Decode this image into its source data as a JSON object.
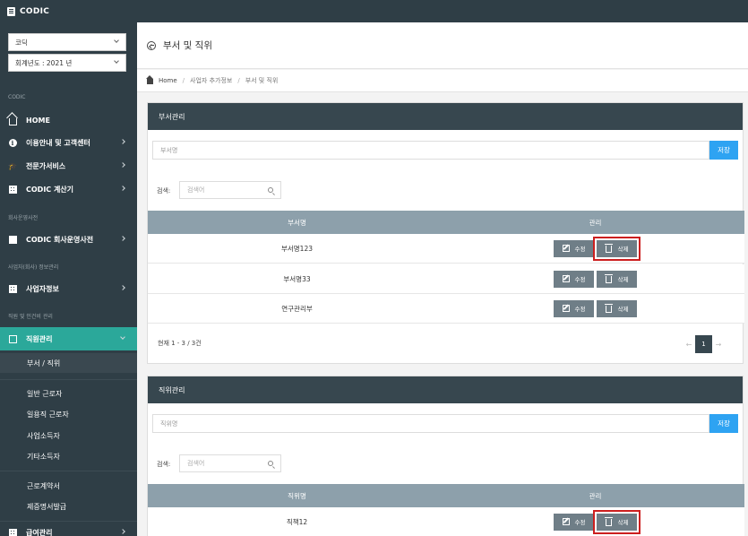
{
  "app": {
    "brand": "CODIC"
  },
  "sidebar": {
    "company_select": "코딕",
    "year_select": "회계년도 : 2021 년",
    "sections": {
      "codic": "CODIC",
      "company_dict": "회사운영사전",
      "biz_info": "사업자(회사) 정보관리",
      "staff": "직원 및 인건비 관리"
    },
    "items": {
      "home": "HOME",
      "support": "이용안내 및 고객센터",
      "expert": "전문가서비스",
      "calculator": "CODIC 계산기",
      "dict": "CODIC 회사운영사전",
      "biz": "사업자정보",
      "staff_mgmt": "직원관리",
      "salary": "급여관리"
    },
    "sub_items": {
      "dept_pos": "부서 / 직위",
      "regular": "일반 근로자",
      "daily": "일용직 근로자",
      "biz_income": "사업소득자",
      "other_income": "기타소득자",
      "contract": "근로계약서",
      "certificate": "제증명서발급"
    }
  },
  "header": {
    "title": "부서 및 직위"
  },
  "breadcrumb": {
    "home": "Home",
    "level1": "사업자 추가정보",
    "level2": "부서 및 직위"
  },
  "dept_panel": {
    "title": "부서관리",
    "name_placeholder": "부서명",
    "save_label": "저장",
    "search_label": "검색:",
    "search_placeholder": "검색어",
    "col_name": "부서명",
    "col_manage": "관리",
    "rows": [
      {
        "name": "부서명123"
      },
      {
        "name": "부서명33"
      },
      {
        "name": "연구관리부"
      }
    ],
    "edit_label": "수정",
    "delete_label": "삭제",
    "paging_info": "현재 1 - 3 / 3건",
    "current_page": "1",
    "prev": "←",
    "next": "→"
  },
  "pos_panel": {
    "title": "직위관리",
    "name_placeholder": "직위명",
    "save_label": "저장",
    "search_label": "검색:",
    "search_placeholder": "검색어",
    "col_name": "직위명",
    "col_manage": "관리",
    "rows": [
      {
        "name": "직책12"
      }
    ],
    "edit_label": "수정",
    "delete_label": "삭제"
  },
  "colors": {
    "sidebar": "#2f3e46",
    "accent": "#2ba89a",
    "save": "#2ea3f2",
    "highlight": "#cc1f1f"
  }
}
